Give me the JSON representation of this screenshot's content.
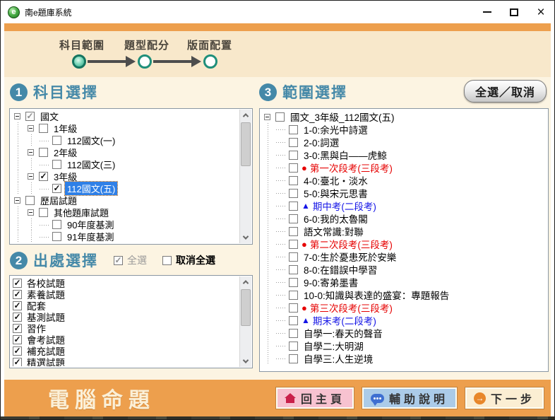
{
  "window": {
    "title": "南e題庫系統",
    "close_glyph": "×"
  },
  "steps": {
    "items": [
      {
        "label": "科目範圍",
        "state": "active"
      },
      {
        "label": "題型配分",
        "state": "pending"
      },
      {
        "label": "版面配置",
        "state": "pending"
      }
    ]
  },
  "glyphs": {
    "check": "✓",
    "red_circle": "●",
    "blue_triangle": "▲"
  },
  "colors": {
    "accent_orange": "#ED9F4D",
    "steps_background": "#F8E8CB",
    "content_background": "#FCF4E2",
    "heading_teal": "#4589A8",
    "step_circle_teal": "#1F8F7A",
    "exam_red": "#E60000",
    "exam_blue": "#1414E6",
    "selected_blue": "#2F80E7",
    "home_button_pink": "#F7C2D0",
    "help_button_blue": "#ABCBE8",
    "next_button_cream": "#FBEED3"
  },
  "subject_panel": {
    "number": "1",
    "title": "科目選擇",
    "tree": [
      {
        "indent": 0,
        "expander": true,
        "check": "gray",
        "label": "國文"
      },
      {
        "indent": 1,
        "expander": true,
        "check": "unchecked",
        "label": "1年級"
      },
      {
        "indent": 2,
        "expander": false,
        "check": "unchecked",
        "label": "112國文(一)"
      },
      {
        "indent": 1,
        "expander": true,
        "check": "unchecked",
        "label": "2年級"
      },
      {
        "indent": 2,
        "expander": false,
        "check": "unchecked",
        "label": "112國文(三)"
      },
      {
        "indent": 1,
        "expander": true,
        "check": "checked",
        "label": "3年級"
      },
      {
        "indent": 2,
        "expander": false,
        "check": "checked",
        "label": "112國文(五)",
        "selected": true
      },
      {
        "indent": 0,
        "expander": true,
        "check": "unchecked",
        "label": "歷屆試題"
      },
      {
        "indent": 1,
        "expander": true,
        "check": "unchecked",
        "label": "其他題庫試題"
      },
      {
        "indent": 2,
        "expander": false,
        "check": "unchecked",
        "label": "90年度基測"
      },
      {
        "indent": 2,
        "expander": false,
        "check": "unchecked",
        "label": "91年度基測"
      }
    ]
  },
  "source_panel": {
    "number": "2",
    "title": "出處選擇",
    "select_all_label": "全選",
    "deselect_all_label": "取消全選",
    "items": [
      {
        "label": "各校試題",
        "checked": true
      },
      {
        "label": "素養試題",
        "checked": true
      },
      {
        "label": "配套",
        "checked": true
      },
      {
        "label": "基測試題",
        "checked": true
      },
      {
        "label": "習作",
        "checked": true
      },
      {
        "label": "會考試題",
        "checked": true
      },
      {
        "label": "補充試題",
        "checked": true
      },
      {
        "label": "精選試題",
        "checked": true
      }
    ]
  },
  "range_panel": {
    "number": "3",
    "title": "範圍選擇",
    "toggle_button_label": "全選／取消",
    "tree": [
      {
        "indent": 0,
        "expander": true,
        "check": "unchecked",
        "label": "國文_3年級_112國文(五)"
      },
      {
        "indent": 1,
        "expander": false,
        "check": "unchecked",
        "label": "1-0:余光中詩選"
      },
      {
        "indent": 1,
        "expander": false,
        "check": "unchecked",
        "label": "2-0:詞選"
      },
      {
        "indent": 1,
        "expander": false,
        "check": "unchecked",
        "label": "3-0:黑與白——虎鯨"
      },
      {
        "indent": 1,
        "expander": false,
        "check": "unchecked",
        "label": "第一次段考(三段考)",
        "color": "red",
        "marker": "red-circle"
      },
      {
        "indent": 1,
        "expander": false,
        "check": "unchecked",
        "label": "4-0:臺北・淡水"
      },
      {
        "indent": 1,
        "expander": false,
        "check": "unchecked",
        "label": "5-0:與宋元思書"
      },
      {
        "indent": 1,
        "expander": false,
        "check": "unchecked",
        "label": "期中考(二段考)",
        "color": "blue",
        "marker": "blue-triangle"
      },
      {
        "indent": 1,
        "expander": false,
        "check": "unchecked",
        "label": "6-0:我的太魯閣"
      },
      {
        "indent": 1,
        "expander": false,
        "check": "unchecked",
        "label": "語文常識:對聯"
      },
      {
        "indent": 1,
        "expander": false,
        "check": "unchecked",
        "label": "第二次段考(三段考)",
        "color": "red",
        "marker": "red-circle"
      },
      {
        "indent": 1,
        "expander": false,
        "check": "unchecked",
        "label": "7-0:生於憂患死於安樂"
      },
      {
        "indent": 1,
        "expander": false,
        "check": "unchecked",
        "label": "8-0:在錯誤中學習"
      },
      {
        "indent": 1,
        "expander": false,
        "check": "unchecked",
        "label": "9-0:寄弟墨書"
      },
      {
        "indent": 1,
        "expander": false,
        "check": "unchecked",
        "label": "10-0:知識與表達的盛宴：專題報告"
      },
      {
        "indent": 1,
        "expander": false,
        "check": "unchecked",
        "label": "第三次段考(三段考)",
        "color": "red",
        "marker": "red-circle"
      },
      {
        "indent": 1,
        "expander": false,
        "check": "unchecked",
        "label": "期末考(二段考)",
        "color": "blue",
        "marker": "blue-triangle"
      },
      {
        "indent": 1,
        "expander": false,
        "check": "unchecked",
        "label": "自學一:春天的聲音"
      },
      {
        "indent": 1,
        "expander": false,
        "check": "unchecked",
        "label": "自學二:大明湖"
      },
      {
        "indent": 1,
        "expander": false,
        "check": "unchecked",
        "label": "自學三:人生逆境"
      }
    ]
  },
  "footer": {
    "title": "電腦命題",
    "home_button": "回主頁",
    "help_button": "輔助說明",
    "next_button": "下一步"
  }
}
